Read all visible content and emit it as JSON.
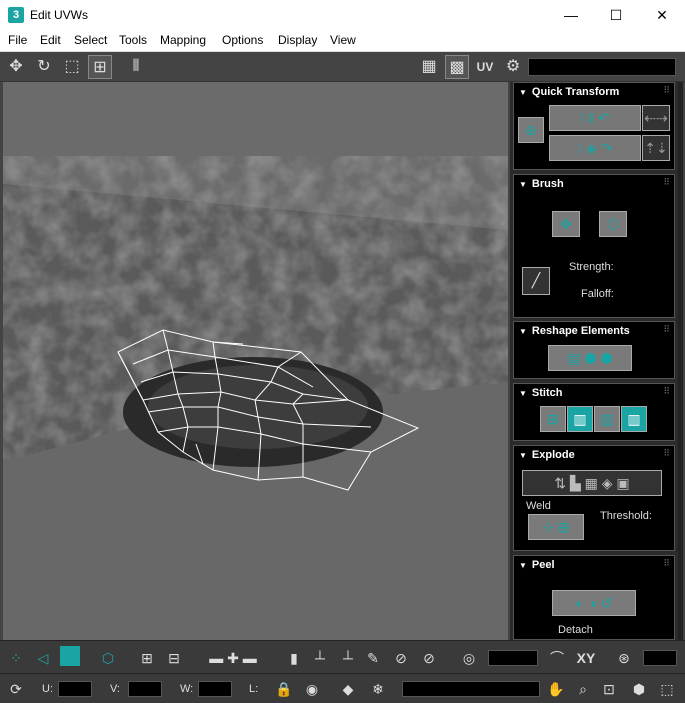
{
  "window": {
    "title": "Edit UVWs",
    "app_icon": "3",
    "min": "—",
    "max": "☐",
    "close": "✕"
  },
  "menu": [
    "File",
    "Edit",
    "Select",
    "Tools",
    "Mapping",
    "Options",
    "Display",
    "View"
  ],
  "toolbar": {
    "uv_label": "UV"
  },
  "panel": {
    "quick_transform": {
      "title": "Quick Transform"
    },
    "brush": {
      "title": "Brush",
      "strength_label": "Strength:",
      "falloff_label": "Falloff:"
    },
    "reshape": {
      "title": "Reshape Elements"
    },
    "stitch": {
      "title": "Stitch"
    },
    "explode": {
      "title": "Explode",
      "weld_label": "Weld",
      "threshold_label": "Threshold:"
    },
    "peel": {
      "title": "Peel",
      "detach_label": "Detach"
    }
  },
  "bottom": {
    "xy_label": "XY",
    "u_label": "U:",
    "v_label": "V:",
    "w_label": "W:",
    "l_label": "L:"
  },
  "colors": {
    "accent": "#1ba4a4",
    "panel_bg": "#000000",
    "ui_bg": "#444444"
  }
}
